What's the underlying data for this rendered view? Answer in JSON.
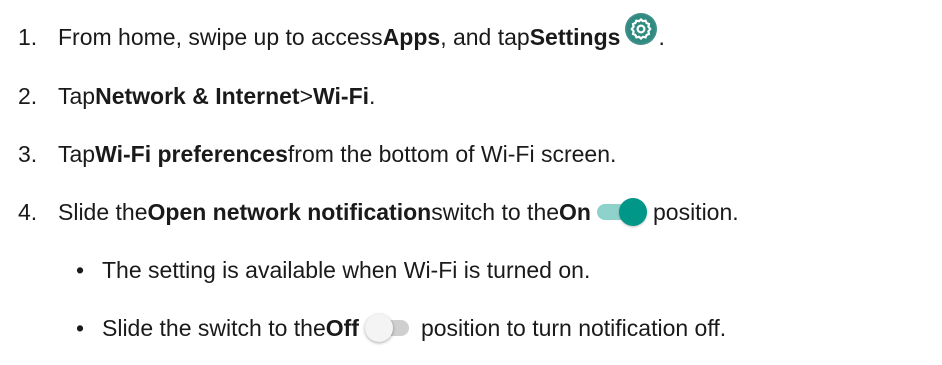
{
  "steps": [
    {
      "number": "1.",
      "parts": [
        "From home, swipe up to access ",
        "Apps",
        ", and tap ",
        "Settings",
        "."
      ]
    },
    {
      "number": "2.",
      "parts": [
        "Tap ",
        "Network & Internet",
        " > ",
        "Wi-Fi",
        "."
      ]
    },
    {
      "number": "3.",
      "parts": [
        "Tap ",
        "Wi-Fi preferences",
        " from the bottom of Wi-Fi screen."
      ]
    },
    {
      "number": "4.",
      "parts": [
        "Slide the ",
        "Open network notification",
        " switch to the ",
        "On",
        " position."
      ]
    }
  ],
  "bullets": [
    {
      "marker": "•",
      "parts": [
        "The setting is available when Wi-Fi is turned on."
      ]
    },
    {
      "marker": "•",
      "parts": [
        "Slide the switch to the ",
        "Off",
        " position to turn notification off."
      ]
    }
  ],
  "icons": {
    "settings": "gear-icon",
    "toggle_on": "toggle-on-icon",
    "toggle_off": "toggle-off-icon"
  },
  "colors": {
    "settings_icon_bg": "#3f8f87",
    "toggle_on_thumb": "#009688",
    "toggle_on_track": "#8fd1cb",
    "toggle_off_track": "#cfcfcf",
    "text": "#1a1a1a"
  }
}
